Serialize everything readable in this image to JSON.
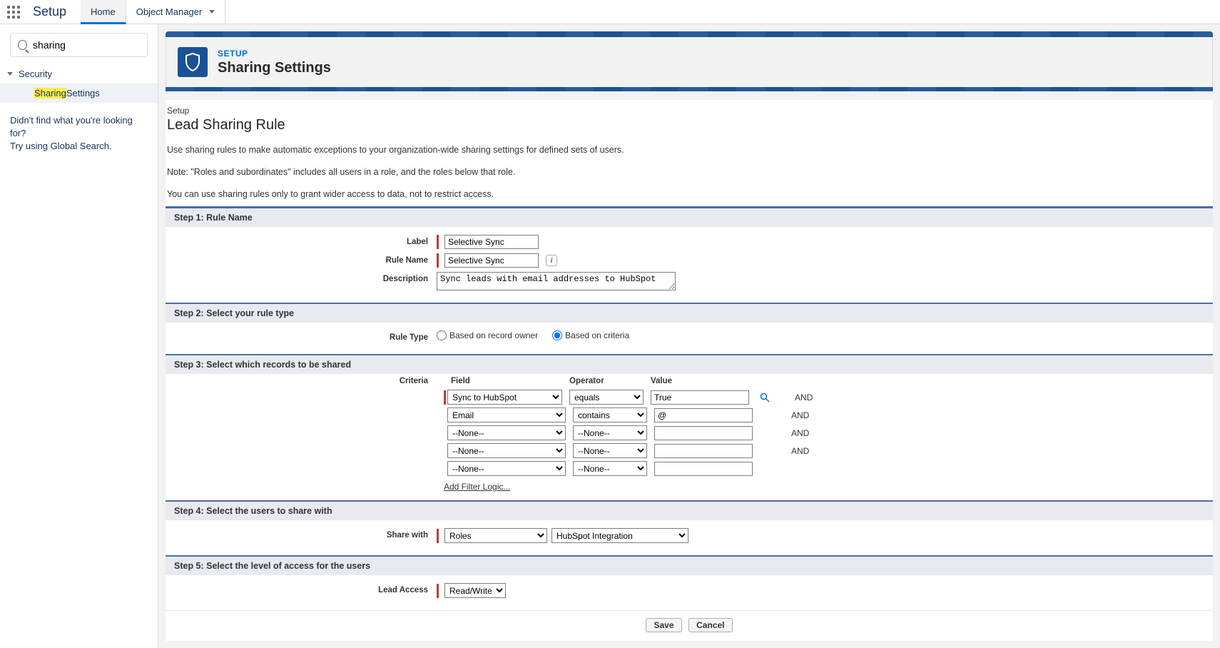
{
  "topbar": {
    "app_title": "Setup",
    "home_tab": "Home",
    "obj_mgr_tab": "Object Manager"
  },
  "sidebar": {
    "search_value": "sharing",
    "tree_root": "Security",
    "tree_leaf_prefix": "Sharing",
    "tree_leaf_suffix": " Settings",
    "not_found_line1": "Didn't find what you're looking for?",
    "not_found_line2": "Try using Global Search."
  },
  "header": {
    "eyebrow": "SETUP",
    "title": "Sharing Settings"
  },
  "page": {
    "crumb": "Setup",
    "title": "Lead Sharing Rule",
    "intro1": "Use sharing rules to make automatic exceptions to your organization-wide sharing settings for defined sets of users.",
    "intro2": "Note: \"Roles and subordinates\" includes all users in a role, and the roles below that role.",
    "intro3": "You can use sharing rules only to grant wider access to data, not to restrict access."
  },
  "steps": {
    "s1": "Step 1: Rule Name",
    "s2": "Step 2: Select your rule type",
    "s3": "Step 3: Select which records to be shared",
    "s4": "Step 4: Select the users to share with",
    "s5": "Step 5: Select the level of access for the users"
  },
  "labels": {
    "label": "Label",
    "rule_name": "Rule Name",
    "description": "Description",
    "rule_type": "Rule Type",
    "criteria": "Criteria",
    "share_with": "Share with",
    "lead_access": "Lead Access",
    "field": "Field",
    "operator": "Operator",
    "value": "Value"
  },
  "values": {
    "label": "Selective Sync",
    "rule_name": "Selective Sync",
    "description": "Sync leads with email addresses to HubSpot",
    "rt_owner": "Based on record owner",
    "rt_criteria": "Based on criteria",
    "add_filter": "Add Filter Logic...",
    "and": "AND",
    "none": "--None--",
    "save": "Save",
    "cancel": "Cancel"
  },
  "criteria_rows": [
    {
      "field": "Sync to HubSpot",
      "op": "equals",
      "val": "True",
      "req": true,
      "and": true,
      "lookup": true
    },
    {
      "field": "Email",
      "op": "contains",
      "val": "@",
      "req": false,
      "and": true,
      "lookup": false
    },
    {
      "field": "--None--",
      "op": "--None--",
      "val": "",
      "req": false,
      "and": true,
      "lookup": false
    },
    {
      "field": "--None--",
      "op": "--None--",
      "val": "",
      "req": false,
      "and": true,
      "lookup": false
    },
    {
      "field": "--None--",
      "op": "--None--",
      "val": "",
      "req": false,
      "and": false,
      "lookup": false
    }
  ],
  "share": {
    "role": "Roles",
    "target": "HubSpot Integration"
  },
  "access": {
    "lead": "Read/Write"
  }
}
